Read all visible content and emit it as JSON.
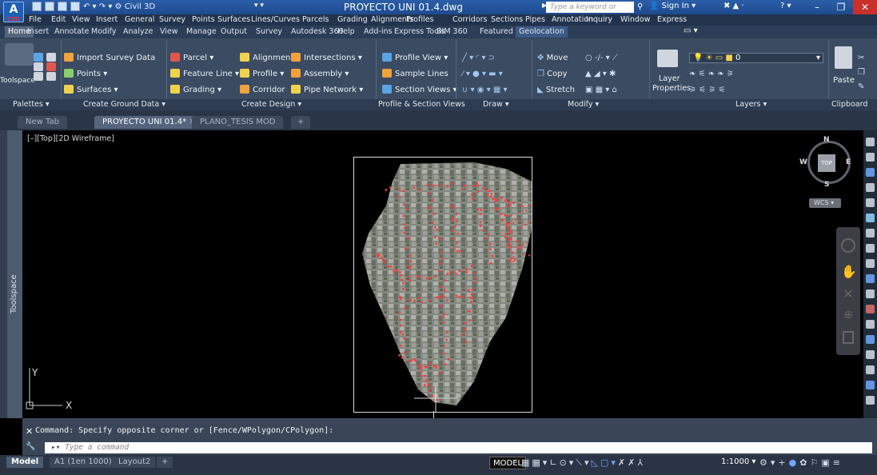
{
  "app": {
    "logo_text": "A",
    "logo_sub": "C3D",
    "workspace": "Civil 3D",
    "document_title": "PROYECTO UNI 01.4.dwg",
    "search_placeholder": "Type a keyword or phrase",
    "signin": "Sign In"
  },
  "window_controls": {
    "minimize": "–",
    "restore": "❐",
    "close": "✕"
  },
  "menubar": [
    "File",
    "Edit",
    "View",
    "Insert",
    "General",
    "Survey",
    "Points",
    "Surfaces",
    "Lines/Curves",
    "Parcels",
    "Grading",
    "Alignments",
    "Profiles",
    "Corridors",
    "Sections",
    "Pipes",
    "Annotation",
    "Inquiry",
    "Window",
    "Express"
  ],
  "ribbon_tabs": [
    "Home",
    "Insert",
    "Annotate",
    "Modify",
    "Analyze",
    "View",
    "Manage",
    "Output",
    "Survey",
    "Autodesk 360",
    "Help",
    "Add-ins",
    "Express Tools",
    "BIM 360",
    "Featured Apps",
    "Geolocation"
  ],
  "ribbon": {
    "toolspace": "Toolspace",
    "import_survey": "Import Survey Data",
    "points": "Points",
    "surfaces": "Surfaces",
    "parcel": "Parcel",
    "feature_line": "Feature Line",
    "grading": "Grading",
    "alignment": "Alignment",
    "profile": "Profile",
    "corridor": "Corridor",
    "intersections": "Intersections",
    "assembly": "Assembly",
    "pipe_network": "Pipe Network",
    "profile_view": "Profile View",
    "sample_lines": "Sample Lines",
    "section_views": "Section Views",
    "move": "Move",
    "copy": "Copy",
    "stretch": "Stretch",
    "layer_properties_1": "Layer",
    "layer_properties_2": "Properties",
    "layer_value": "0",
    "paste": "Paste"
  },
  "panels": [
    "Palettes",
    "Create Ground Data",
    "Create Design",
    "Profile & Section Views",
    "Draw",
    "Modify",
    "Layers",
    "Clipboard"
  ],
  "doc_tabs": [
    "New Tab",
    "PROYECTO UNI 01.4*",
    "PLANO_TESIS MOD"
  ],
  "viewport": {
    "label": "[–][Top][2D Wireframe]",
    "compass": {
      "n": "N",
      "s": "S",
      "e": "E",
      "w": "W",
      "top": "TOP",
      "wcs": "WCS"
    },
    "axis_x": "X",
    "axis_y": "Y"
  },
  "command": {
    "history": "Command: Specify opposite corner or [Fence/WPolygon/CPolygon]:",
    "placeholder": "Type a command"
  },
  "layout_tabs": [
    "Model",
    "A1 (1en 1000)",
    "Layout2"
  ],
  "status": {
    "model": "MODEL",
    "scale": "1:1000"
  },
  "colors": {
    "ribbon_bg": "#3b4b61",
    "title_bg": "#2b5ea8",
    "point_red": "#ff3b3b",
    "close_red": "#c9302c"
  }
}
